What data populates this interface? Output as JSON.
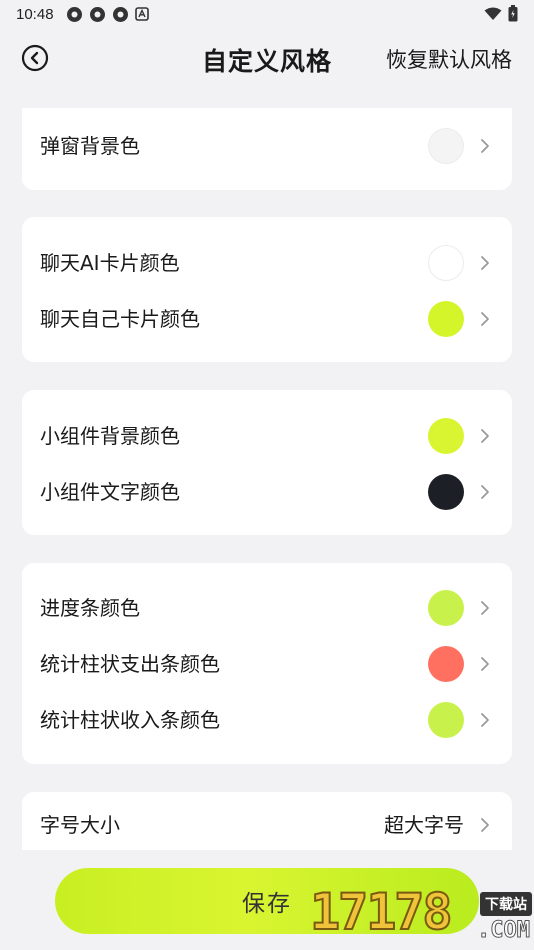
{
  "status_bar": {
    "time": "10:48",
    "notification_icons": [
      "aperture-icon",
      "aperture-icon",
      "aperture-icon",
      "a-badge-icon"
    ],
    "right_icons": [
      "wifi-icon",
      "battery-icon"
    ]
  },
  "header": {
    "back_icon": "chevron-left-circle-icon",
    "title": "自定义风格",
    "restore_label": "恢复默认风格"
  },
  "settings": {
    "popup_bg": {
      "label": "弹窗背景色",
      "color": "#f4f4f4"
    },
    "chat_ai_card": {
      "label": "聊天AI卡片颜色",
      "color": "#ffffff"
    },
    "chat_self_card": {
      "label": "聊天自己卡片颜色",
      "color": "#d4f52a"
    },
    "widget_bg": {
      "label": "小组件背景颜色",
      "color": "#d9f531"
    },
    "widget_text": {
      "label": "小组件文字颜色",
      "color": "#1c2026"
    },
    "progress_bar": {
      "label": "进度条颜色",
      "color": "#c8f24b"
    },
    "stat_expense_bar": {
      "label": "统计柱状支出条颜色",
      "color": "#ff7060"
    },
    "stat_income_bar": {
      "label": "统计柱状收入条颜色",
      "color": "#c8f24b"
    },
    "font_size": {
      "label": "字号大小",
      "value": "超大字号"
    }
  },
  "footer": {
    "save_label": "保存"
  },
  "watermark": {
    "number": "17178",
    "tag": "下载站",
    "domain": ".COM"
  }
}
